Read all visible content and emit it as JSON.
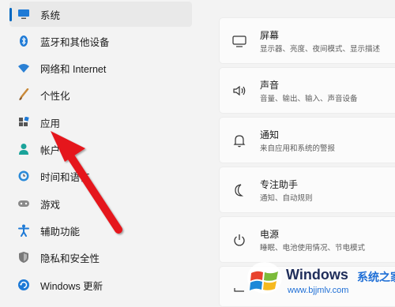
{
  "sidebar": {
    "items": [
      {
        "label": "系统",
        "icon": "monitor-icon",
        "selected": true
      },
      {
        "label": "蓝牙和其他设备",
        "icon": "bluetooth-icon"
      },
      {
        "label": "网络和 Internet",
        "icon": "wifi-icon"
      },
      {
        "label": "个性化",
        "icon": "brush-icon"
      },
      {
        "label": "应用",
        "icon": "apps-icon"
      },
      {
        "label": "帐户",
        "icon": "person-icon"
      },
      {
        "label": "时间和语言",
        "icon": "globe-clock-icon"
      },
      {
        "label": "游戏",
        "icon": "gamepad-icon"
      },
      {
        "label": "辅助功能",
        "icon": "accessibility-icon"
      },
      {
        "label": "隐私和安全性",
        "icon": "shield-icon"
      },
      {
        "label": "Windows 更新",
        "icon": "update-icon"
      }
    ]
  },
  "cards": [
    {
      "title": "屏幕",
      "subtitle": "显示器、亮度、夜间模式、显示描述",
      "icon": "display-icon"
    },
    {
      "title": "声音",
      "subtitle": "音量、输出、输入、声音设备",
      "icon": "speaker-icon"
    },
    {
      "title": "通知",
      "subtitle": "来自应用和系统的警报",
      "icon": "bell-icon"
    },
    {
      "title": "专注助手",
      "subtitle": "通知、自动规则",
      "icon": "moon-icon"
    },
    {
      "title": "电源",
      "subtitle": "睡眠、电池使用情况、节电模式",
      "icon": "power-icon"
    }
  ],
  "watermark": {
    "brand": "Windows",
    "brand_cn": "系统之家",
    "url": "www.bjjmlv.com"
  },
  "colors": {
    "accent": "#0067c0",
    "arrow": "#e5171b"
  }
}
